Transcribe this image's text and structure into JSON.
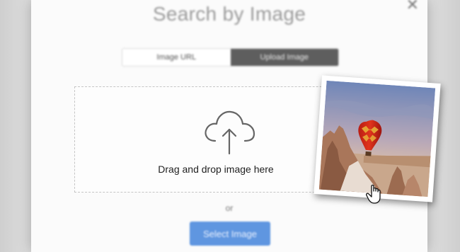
{
  "dialog": {
    "title": "Search by Image",
    "close_icon": "close-icon",
    "tabs": [
      {
        "label": "Image URL",
        "active": false
      },
      {
        "label": "Upload Image",
        "active": true
      }
    ],
    "dropzone": {
      "icon": "cloud-upload-icon",
      "text": "Drag and drop image here"
    },
    "or_text": "or",
    "select_button": "Select Image"
  },
  "dragged_photo": {
    "icon": "image-thumbnail",
    "cursor": "hand-grab-icon"
  },
  "colors": {
    "active_tab": "#5e5e5e",
    "primary_button": "#5f96e0",
    "dropzone_border": "#c5c5c5"
  }
}
